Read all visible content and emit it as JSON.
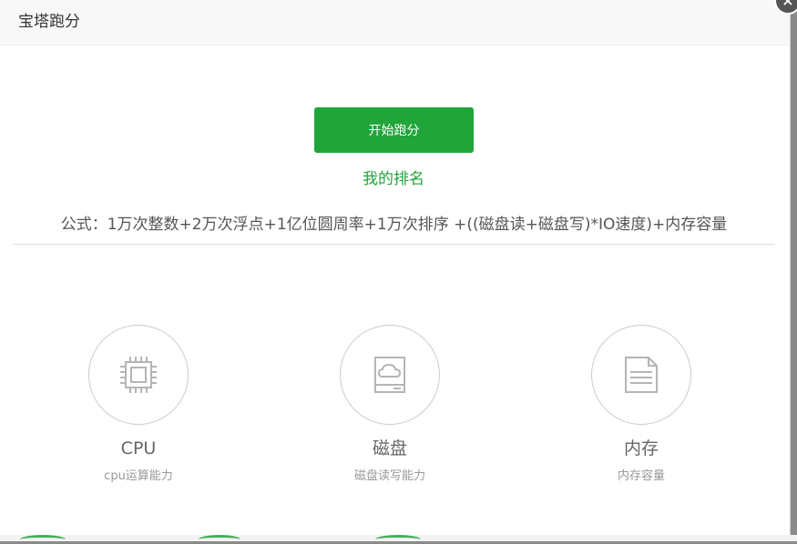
{
  "dialog": {
    "title": "宝塔跑分",
    "close_label": "×"
  },
  "actions": {
    "start_label": "开始跑分",
    "rank_label": "我的排名"
  },
  "formula": "公式：1万次整数+2万次浮点+1亿位圆周率+1万次排序 +((磁盘读+磁盘写)*IO速度)+内存容量",
  "metrics": [
    {
      "title": "CPU",
      "subtitle": "cpu运算能力",
      "icon": "cpu-chip-icon"
    },
    {
      "title": "磁盘",
      "subtitle": "磁盘读写能力",
      "icon": "disk-cloud-icon"
    },
    {
      "title": "内存",
      "subtitle": "内存容量",
      "icon": "memory-file-icon"
    }
  ],
  "colors": {
    "accent": "#20a53a",
    "icon_gray": "#b5b5b5"
  }
}
